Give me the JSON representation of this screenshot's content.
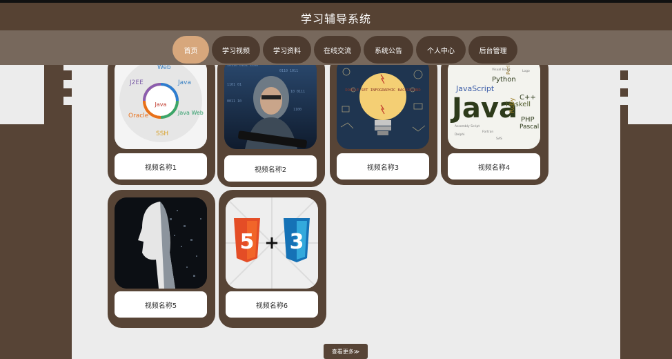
{
  "header": {
    "title": "学习辅导系统"
  },
  "nav": {
    "items": [
      {
        "label": "首页",
        "active": true
      },
      {
        "label": "学习视频"
      },
      {
        "label": "学习资料"
      },
      {
        "label": "在线交流"
      },
      {
        "label": "系统公告"
      },
      {
        "label": "个人中心"
      },
      {
        "label": "后台管理"
      }
    ]
  },
  "videos": [
    {
      "name": "视频名称1",
      "thumb": "java-tech-wheel"
    },
    {
      "name": "视频名称2",
      "thumb": "hacker-code-screen"
    },
    {
      "name": "视频名称3",
      "thumb": "doodle-lightbulb"
    },
    {
      "name": "视频名称4",
      "thumb": "java-word-cloud"
    },
    {
      "name": "视频名称5",
      "thumb": "ai-robot-head"
    },
    {
      "name": "视频名称6",
      "thumb": "html5-plus-css3"
    }
  ],
  "thumb_text": {
    "doodle": "DOODLE SET INFOGRAPHIC BACKGROUND",
    "java": "Java",
    "wheel": {
      "j2ee": "J2EE",
      "web": "Web",
      "java": "Java",
      "oracle": "Oracle",
      "javaweb": "Java Web",
      "ssh": "SSH",
      "center": "Java"
    },
    "cloud": [
      "JavaScript",
      "Python",
      "C++",
      "Haskell",
      "Ruby",
      "PHP",
      "Pascal",
      "Perl"
    ]
  },
  "more_button": {
    "label": "查看更多≫"
  },
  "colors": {
    "brown": "#574436",
    "accent": "#d7a77c",
    "panel": "#ececec"
  }
}
